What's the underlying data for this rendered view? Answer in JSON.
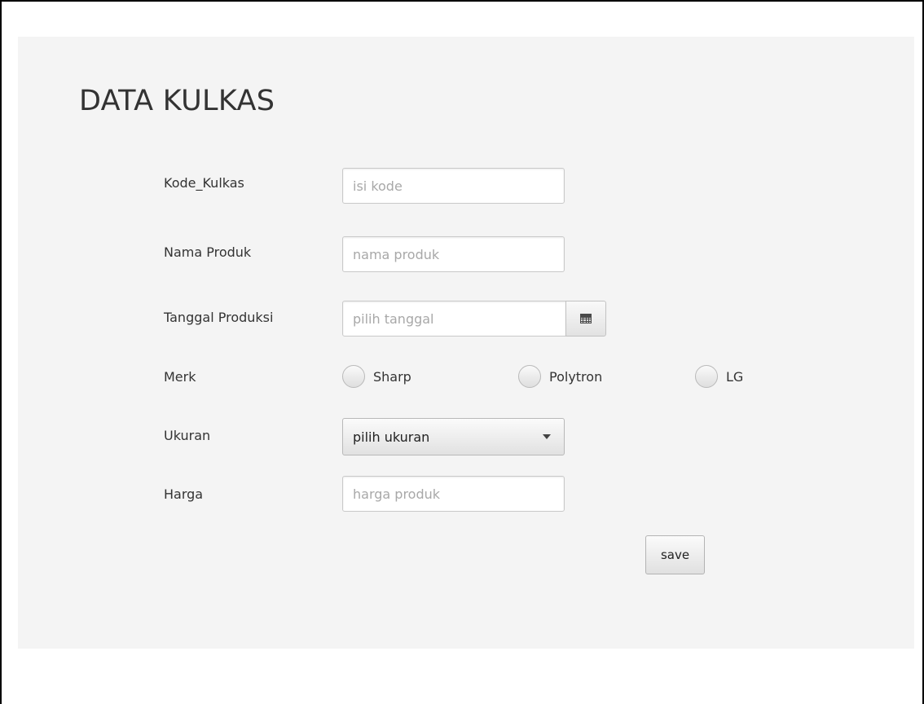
{
  "form": {
    "title": "DATA KULKAS",
    "kode": {
      "label": "Kode_Kulkas",
      "placeholder": "isi kode",
      "value": ""
    },
    "nama": {
      "label": "Nama Produk",
      "placeholder": "nama produk",
      "value": ""
    },
    "tanggal": {
      "label": "Tanggal Produksi",
      "placeholder": "pilih tanggal",
      "value": ""
    },
    "merk": {
      "label": "Merk",
      "options": [
        "Sharp",
        "Polytron",
        "LG"
      ]
    },
    "ukuran": {
      "label": "Ukuran",
      "selected": "pilih ukuran"
    },
    "harga": {
      "label": "Harga",
      "placeholder": "harga produk",
      "value": ""
    },
    "save_label": "save"
  },
  "icons": {
    "date_picker": "calendar-icon",
    "dropdown": "chevron-down-icon"
  }
}
